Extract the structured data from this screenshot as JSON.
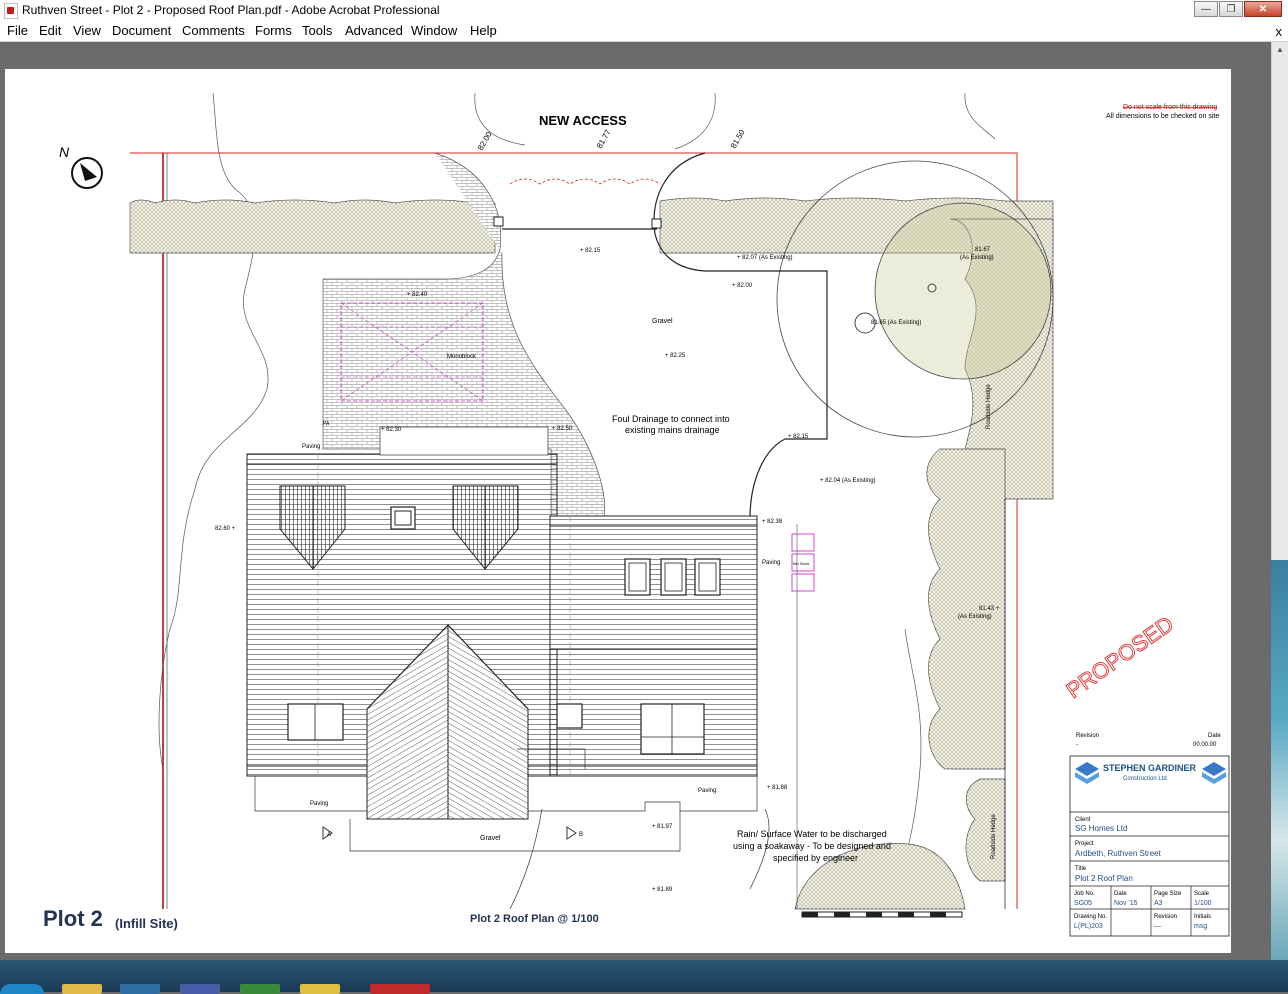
{
  "window": {
    "title": "Ruthven Street - Plot 2 - Proposed Roof Plan.pdf - Adobe Acrobat Professional",
    "minimize": "—",
    "maximize": "❐",
    "close": "✕"
  },
  "menu": [
    "File",
    "Edit",
    "View",
    "Document",
    "Comments",
    "Forms",
    "Tools",
    "Advanced",
    "Window",
    "Help"
  ],
  "menu_close": "x",
  "drawing": {
    "new_access": "NEW ACCESS",
    "north": "N",
    "note1": "Do not scale from this drawing",
    "note2": "All dimensions to be checked on site",
    "lvl_a": "82.00",
    "lvl_b": "81.77",
    "lvl_c": "81.50",
    "lvl_8215": "+ 82.15",
    "lvl_8207": "+ 82.07 (As Existing)",
    "lvl_8200": "+ 82.00",
    "lvl_8167": "81.67",
    "lvl_as_existing": "(As Existing)",
    "lvl_8165": "81.65 (As Existing)",
    "lvl_8225": "+ 82.25",
    "lvl_8240": "+ 82.40",
    "lvl_8230": "+ 82.30",
    "lvl_8250": "+ 82.50",
    "lvl_8215b": "+ 82.15",
    "lvl_8204": "+ 82.04 (As Existing)",
    "lvl_8238": "+ 82.38",
    "lvl_8260": "82.60 +",
    "lvl_8143": "81.43 +",
    "lvl_8188": "+ 81.88",
    "lvl_8197": "+ 81.97",
    "lvl_8189": "+ 81.89",
    "gravel": "Gravel",
    "gravel2": "Gravel",
    "monoblock": "Monoblock",
    "foul1": "Foul Drainage to connect into",
    "foul2": "existing mains drainage",
    "paving1": "Paving",
    "paving2": "Paving",
    "paving3": "Paving",
    "paving4": "Paving",
    "rain1": "Rain/ Surface Water to be discharged",
    "rain2": "using a soakaway - To be designed and",
    "rain3": "specified by engineer",
    "hedge1": "Roadside Hedge",
    "hedge2": "Roadside Hedge",
    "plot_title": "Plot 2",
    "plot_sub": "(Infill Site)",
    "roof_title": "Plot 2 Roof Plan @ 1/100",
    "proposed": "PROPOSED",
    "bin": "Bin Store",
    "sec_a": "A",
    "sec_b": "B",
    "pa": "PA"
  },
  "titleblock": {
    "revision_label": "Revision",
    "date_label": "Date",
    "revision_val": "-",
    "date_val": "00.00.00",
    "company": "STEPHEN GARDINER",
    "company_sub": "Construction Ltd",
    "client_label": "Client",
    "client": "SG Homes Ltd",
    "project_label": "Project",
    "project": "Ardbeth, Ruthven Street",
    "title_label": "Title",
    "title": "Plot 2 Roof Plan",
    "jobno_label": "Job No.",
    "jobno": "SG05",
    "date2_label": "Date",
    "date2": "Nov '15",
    "pagesize_label": "Page Size",
    "pagesize": "A3",
    "scale_label": "Scale",
    "scale": "1/100",
    "drawingno_label": "Drawing No.",
    "drawingno": "L(PL)203",
    "rev_label": "Revision",
    "rev": "—",
    "initials_label": "Initials",
    "initials": "msg"
  }
}
